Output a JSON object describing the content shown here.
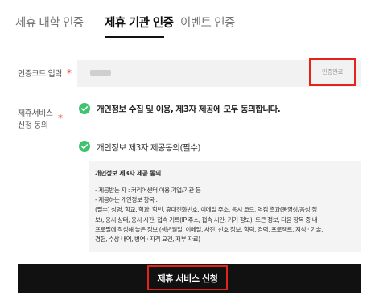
{
  "tabs": [
    {
      "label": "제휴 대학 인증",
      "active": false
    },
    {
      "label": "제휴 기관 인증",
      "active": true
    },
    {
      "label": "이벤트 인증",
      "active": false
    }
  ],
  "auth_code": {
    "label": "인증코드 입력",
    "required_mark": "*",
    "confirm_button": "인증완료"
  },
  "consent": {
    "label_line1": "제휴서비스",
    "label_line2": "신청 동의",
    "required_mark": "*",
    "agree_all": "개인정보 수집 및 이용, 제3자 제공에 모두 동의합니다.",
    "agree_third_party": "개인정보 제3자 제공동의(필수)",
    "terms": {
      "title": "개인정보 제3자 제공 동의",
      "lines": [
        "- 제공받는 자 : 커리어센터 이용 기업/기관 등",
        "- 제공하는 개인정보 항목 :",
        "(필수) 성명, 학교, 학과, 학번, 휴대전화번호, 이메일 주소, 응시 코드, 역검 결과(동영상/음성 정",
        "보), 응시 상태, 응시 시간, 접속 기록(IP 주소, 접속 시간, 기기 정보), 토큰 정보, 다음 항목 중 내",
        "프로필에 작성해 놓은 정보 (생년월일, 이메일, 사진, 선호 정보, 학력, 경력, 프로젝트, 지식 · 기술,",
        "경험, 수상 내역, 병역 · 자격 요건, 저부 자료)"
      ]
    }
  },
  "submit_button": "제휴 서비스 신청",
  "colors": {
    "accent_red": "#e5231a",
    "check_green": "#3ec46d",
    "dark": "#111111"
  }
}
